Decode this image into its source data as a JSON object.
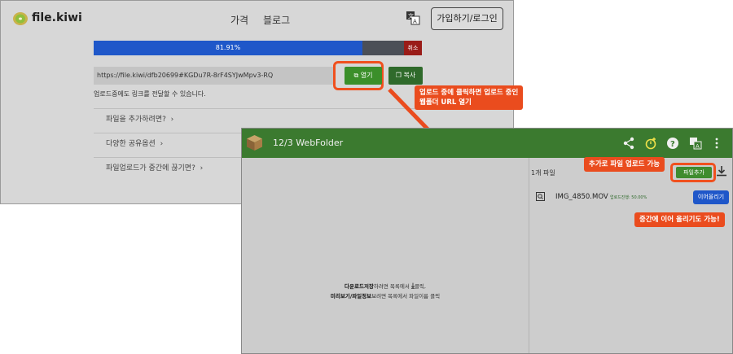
{
  "site": {
    "brand": "file.kiwi",
    "nav": [
      "가격",
      "블로그"
    ],
    "login_label": "가입하기/로그인"
  },
  "upload": {
    "progress_text": "81.91%",
    "progress": 0.8191,
    "cancel_label": "취소",
    "url": "https://file.kiwi/dfb20699#KGDu7R-8rF4SYJwMpv3-RQ",
    "open_label": "열기",
    "copy_label": "복사",
    "note": "업로드중에도 링크를 전달할 수 있습니다.",
    "faq": [
      "파일을 추가하려면?",
      "다양한 공유옵션",
      "파일업로드가 중간에 끊기면?"
    ]
  },
  "callouts": {
    "open_line1": "업로드 중에 클릭하면 업로드 중인",
    "open_line2": "웹폴더 URL 열기",
    "add": "추가로 파일 업로드 가능",
    "resume": "중간에 이어 올리기도 가능!"
  },
  "webfolder": {
    "title": "12/3 WebFolder",
    "file_count": "1개 파일",
    "add_label": "파일추가",
    "file": {
      "name": "IMG_4850.MOV",
      "progress_text": "업로드진행: 50.00%",
      "resume_label": "이어올리기"
    },
    "center": {
      "line1_bold": "다운로드저장",
      "line1_rest": "하려면 목록에서",
      "line1_end": "클릭,",
      "line2_bold": "미리보기/파일정보",
      "line2_rest": "보려면 목록에서 파일이름 클릭"
    }
  },
  "colors": {
    "accent_green": "#3b7a2f",
    "progress_blue": "#1f57c9",
    "callout_orange": "#ea4c1e",
    "cancel_red": "#9a1c18"
  },
  "icons": [
    "kiwi-logo-icon",
    "translate-icon",
    "external-link-icon",
    "copy-icon",
    "box-icon",
    "share-icon",
    "update-icon",
    "help-icon",
    "more-icon",
    "download-icon",
    "file-preview-icon",
    "chevron-right-icon"
  ]
}
